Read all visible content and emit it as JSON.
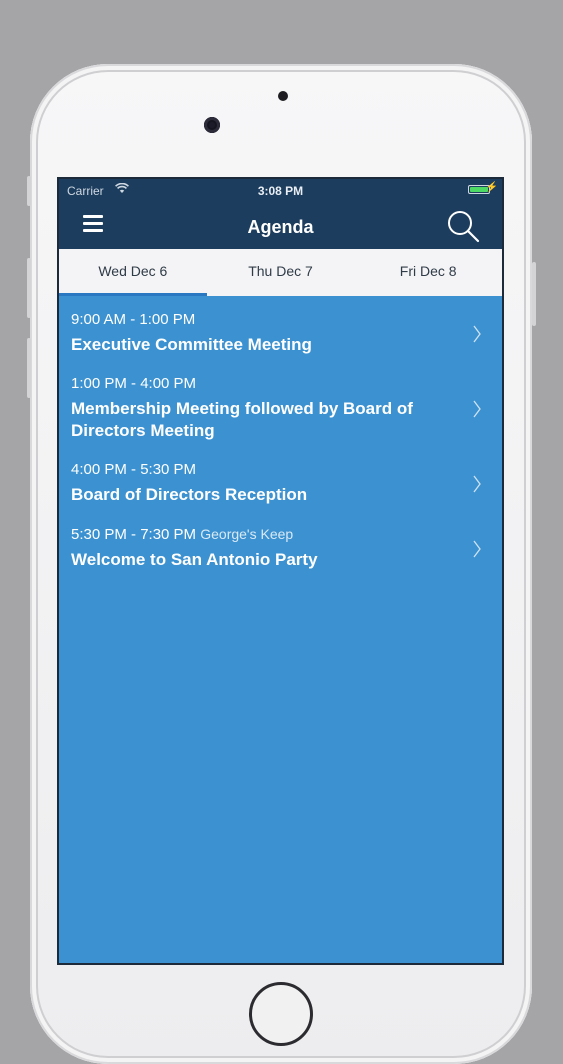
{
  "status_bar": {
    "carrier": "Carrier",
    "time": "3:08 PM"
  },
  "nav": {
    "title": "Agenda"
  },
  "tabs": [
    {
      "label": "Wed  Dec 6",
      "active": true
    },
    {
      "label": "Thu  Dec 7",
      "active": false
    },
    {
      "label": "Fri  Dec 8",
      "active": false
    }
  ],
  "events": [
    {
      "time": "9:00 AM - 1:00 PM",
      "location": "",
      "title": "Executive Committee Meeting"
    },
    {
      "time": "1:00 PM - 4:00 PM",
      "location": "",
      "title": "Membership Meeting followed by Board of Directors Meeting"
    },
    {
      "time": "4:00 PM - 5:30 PM",
      "location": "",
      "title": "Board of Directors Reception"
    },
    {
      "time": "5:30 PM - 7:30 PM",
      "location": "George's Keep",
      "title": "Welcome to San Antonio Party"
    }
  ],
  "colors": {
    "nav_bg": "#1c3d5d",
    "list_bg": "#3c92d0",
    "tab_bg": "#f4f4f6",
    "tab_indicator": "#2b78c2",
    "battery": "#4cd964"
  }
}
